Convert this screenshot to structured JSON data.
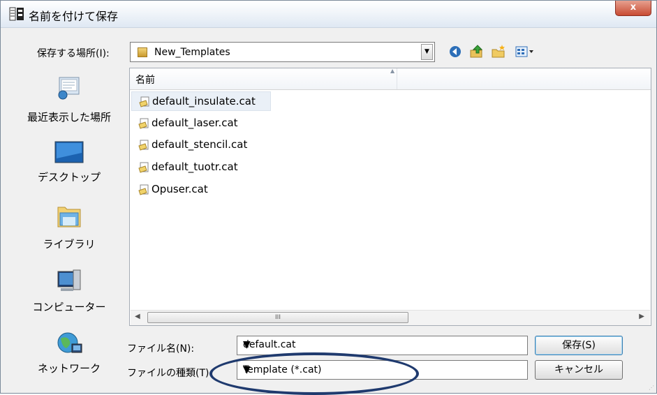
{
  "window": {
    "title": "名前を付けて保存",
    "close_label": "x"
  },
  "lookin": {
    "label": "保存する場所(I):",
    "value": "New_Templates"
  },
  "toolbar": {
    "icons": [
      "back-icon",
      "up-folder-icon",
      "new-folder-icon",
      "view-menu-icon"
    ]
  },
  "places": [
    {
      "label": "最近表示した場所",
      "icon": "recent-places-icon"
    },
    {
      "label": "デスクトップ",
      "icon": "desktop-icon"
    },
    {
      "label": "ライブラリ",
      "icon": "libraries-icon"
    },
    {
      "label": "コンピューター",
      "icon": "computer-icon"
    },
    {
      "label": "ネットワーク",
      "icon": "network-icon"
    }
  ],
  "filelist": {
    "column_header": "名前",
    "files": [
      {
        "name": "default_insulate.cat",
        "selected": true
      },
      {
        "name": "default_laser.cat",
        "selected": false
      },
      {
        "name": "default_stencil.cat",
        "selected": false
      },
      {
        "name": "default_tuotr.cat",
        "selected": false
      },
      {
        "name": "Opuser.cat",
        "selected": false
      }
    ],
    "scroll_thumb_glyph": "III"
  },
  "form": {
    "filename_label": "ファイル名(N):",
    "filename_value": "default.cat",
    "filetype_label": "ファイルの種類(T):",
    "filetype_value": "Template (*.cat)"
  },
  "buttons": {
    "save": "保存(S)",
    "cancel": "キャンセル"
  },
  "colors": {
    "annotation_ellipse": "#1f3a6e",
    "close_button": "#c84b33"
  }
}
